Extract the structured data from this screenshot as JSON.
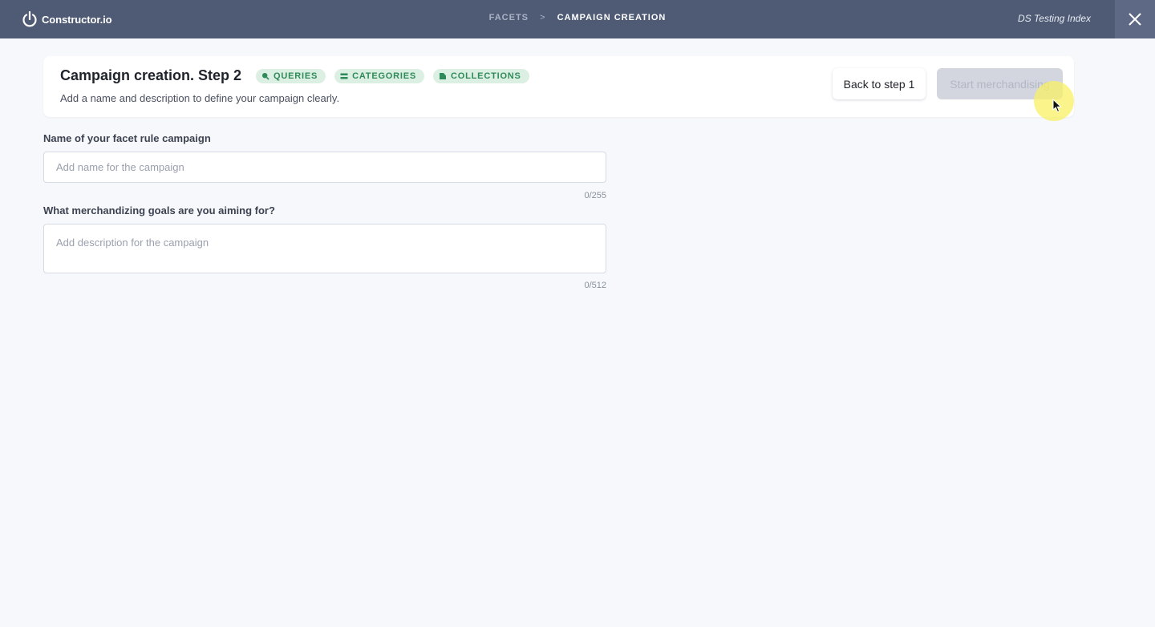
{
  "header": {
    "brand_name": "Constructor.io",
    "breadcrumb": [
      "FACETS",
      "CAMPAIGN CREATION"
    ],
    "breadcrumb_separator": ">",
    "index_name": "DS Testing Index",
    "close_icon": "close-icon"
  },
  "step_card": {
    "title": "Campaign creation. Step 2",
    "subtitle": "Add a name and description to define your campaign clearly.",
    "tags": [
      {
        "label": "QUERIES",
        "icon": "search-icon"
      },
      {
        "label": "CATEGORIES",
        "icon": "list-icon"
      },
      {
        "label": "COLLECTIONS",
        "icon": "collection-icon"
      }
    ],
    "back_button": "Back to step 1",
    "start_button": "Start merchandising"
  },
  "form": {
    "name_field": {
      "label": "Name of your facet rule campaign",
      "placeholder": "Add name for the campaign",
      "value": "",
      "counter": "0/255"
    },
    "description_field": {
      "label": "What merchandizing goals are you aiming for?",
      "placeholder": "Add description for the campaign",
      "value": "",
      "counter": "0/512"
    }
  },
  "colors": {
    "topbar": "#4f5b75",
    "tag_bg": "#dcefe3",
    "tag_text": "#2f8a59",
    "disabled_button": "#d3d6df"
  }
}
